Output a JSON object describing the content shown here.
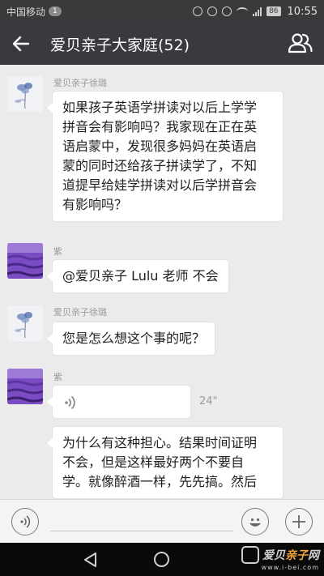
{
  "status_bar": {
    "carrier": "中国移动",
    "notification_count": "1",
    "battery": "86",
    "time": "10:55"
  },
  "header": {
    "title": "爱贝亲子大家庭(52)",
    "back_icon": "arrow-left-icon",
    "members_icon": "group-members-icon"
  },
  "messages": [
    {
      "sender": "爱贝亲子徐璐",
      "avatar": "blue-flower-drawing",
      "type": "text",
      "lines": [
        "如果孩子英语学拼读对以后上学学",
        "拼音会有影响吗？我家现在正在英",
        "语启蒙中，发现很多妈妈在英语启",
        "蒙的同时还给孩子拼读学了，不知",
        "道提早给娃学拼读对以后学拼音会",
        "有影响吗？"
      ]
    },
    {
      "sender": "紫",
      "avatar": "lavender-field",
      "type": "text",
      "lines": [
        "@爱贝亲子 Lulu 老师  不会"
      ]
    },
    {
      "sender": "爱贝亲子徐璐",
      "avatar": "blue-flower-drawing",
      "type": "text",
      "lines": [
        "您是怎么想这个事的呢？"
      ]
    },
    {
      "sender": "紫",
      "avatar": "lavender-field",
      "type": "voice",
      "duration": "24\""
    },
    {
      "sender": "",
      "avatar": "",
      "type": "text",
      "lines": [
        "为什么有这种担心。结果时间证明",
        "不会，但是这样最好两个不要自",
        "学。就像醉酒一样，先先搞。然后"
      ]
    }
  ],
  "input_bar": {
    "voice_icon": "voice-mode-icon",
    "emoji_icon": "emoji-face-icon",
    "more_icon": "plus-icon"
  },
  "nav_bar": {
    "back_icon": "triangle-back-icon",
    "home_icon": "circle-home-icon"
  },
  "watermark": {
    "text_a": "爱贝",
    "text_b": "亲子",
    "text_c": "网",
    "url": "www.i-bei.com"
  },
  "colors": {
    "title_bar": "#393a3f",
    "chat_background": "#ebebeb",
    "bubble": "#ffffff",
    "watermark_accent": "#f2a33a"
  }
}
